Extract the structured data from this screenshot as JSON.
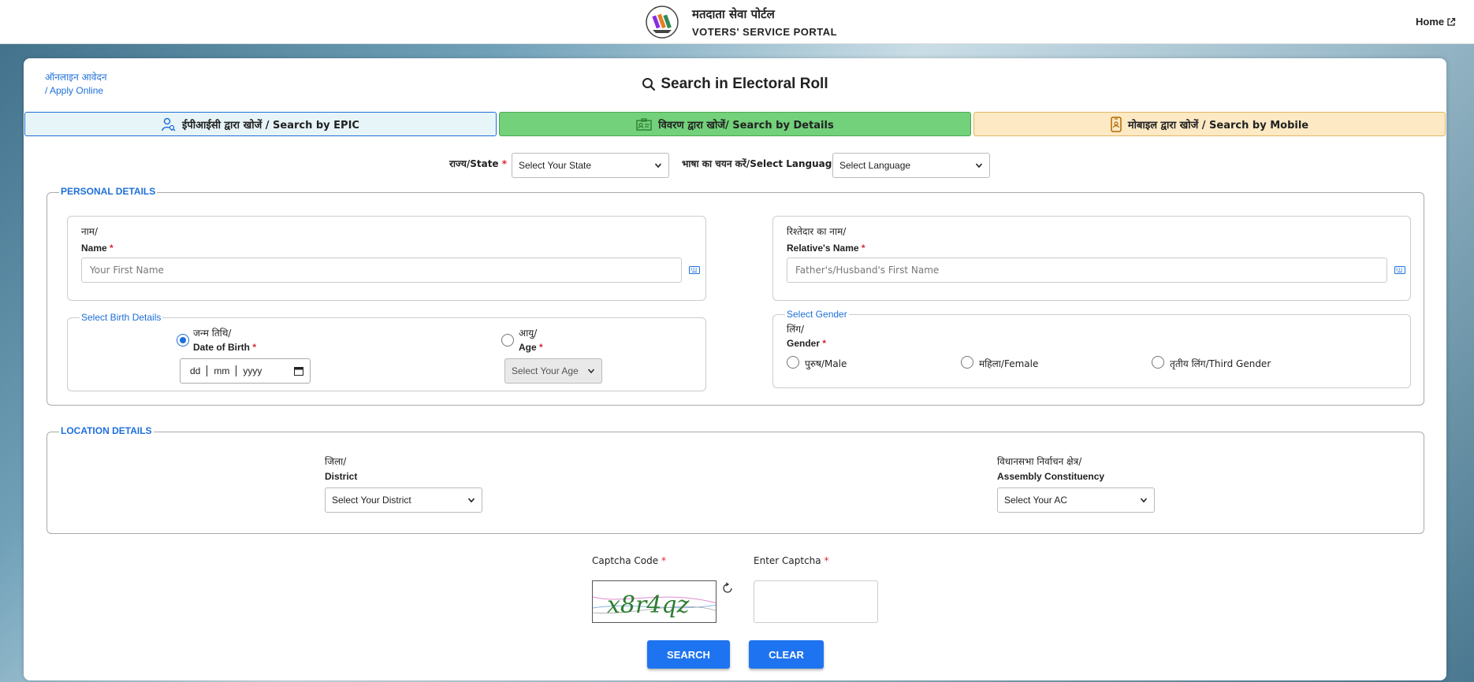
{
  "header": {
    "title_hi": "मतदाता सेवा पोर्टल",
    "title_en": "VOTERS' SERVICE PORTAL",
    "home_label": "Home"
  },
  "apply_online": {
    "hi": "ऑनलाइन आवेदन",
    "en": "/ Apply Online"
  },
  "page_title": "Search in Electoral Roll",
  "tabs": [
    {
      "label": "ईपीआईसी द्वारा खोजें / Search by EPIC"
    },
    {
      "label": "विवरण द्वारा खोजें/ Search by Details"
    },
    {
      "label": "मोबाइल द्वारा खोजें / Search by Mobile"
    }
  ],
  "state": {
    "label": "राज्य/State",
    "value": "Select Your State"
  },
  "language": {
    "label": "भाषा का चयन करें/Select Language",
    "value": "Select Language"
  },
  "personal": {
    "legend": "PERSONAL DETAILS",
    "name": {
      "label_hi": "नाम/",
      "label_en": "Name",
      "placeholder": "Your First Name"
    },
    "relative": {
      "label_hi": "रिश्तेदार का नाम/",
      "label_en": "Relative's Name",
      "placeholder": "Father's/Husband's First Name"
    },
    "birth": {
      "legend": "Select Birth Details",
      "dob_hi": "जन्म तिथि/",
      "dob_en": "Date of Birth",
      "age_hi": "आयु/",
      "age_en": "Age",
      "date_dd": "dd",
      "date_mm": "mm",
      "date_yyyy": "yyyy",
      "age_value": "Select Your Age"
    },
    "gender": {
      "legend": "Select Gender",
      "label_hi": "लिंग/",
      "label_en": "Gender",
      "male": "पुरुष/Male",
      "female": "महिला/Female",
      "third": "तृतीय लिंग/Third Gender"
    }
  },
  "location": {
    "legend": "LOCATION DETAILS",
    "district": {
      "label_hi": "जिला/",
      "label_en": "District",
      "value": "Select Your District"
    },
    "ac": {
      "label_hi": "विधानसभा निर्वाचन क्षेत्र/",
      "label_en": "Assembly Constituency",
      "value": "Select Your AC"
    }
  },
  "captcha": {
    "code_label": "Captcha Code",
    "enter_label": "Enter Captcha",
    "text": "x8r4qz"
  },
  "buttons": {
    "search": "SEARCH",
    "clear": "CLEAR"
  },
  "required_mark": "*",
  "colors": {
    "accent": "#1e6fd9",
    "required": "#d9272e",
    "tab_details": "#72d17a",
    "tab_mobile": "#fde9c4",
    "tab_epic": "#e8f5f8",
    "button": "#1e74f0"
  }
}
